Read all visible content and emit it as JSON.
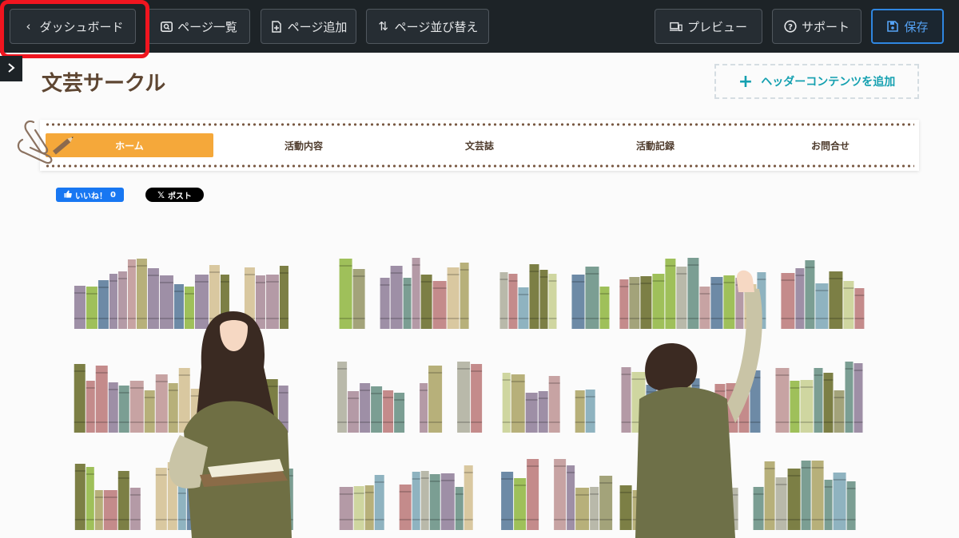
{
  "toolbar": {
    "dashboard_label": "ダッシュボード",
    "page_list_label": "ページ一覧",
    "add_page_label": "ページ追加",
    "reorder_label": "ページ並び替え",
    "preview_label": "プレビュー",
    "support_label": "サポート",
    "save_label": "保存"
  },
  "site": {
    "title": "文芸サークル",
    "add_header_label": "ヘッダーコンテンツを追加"
  },
  "nav": {
    "items": [
      {
        "label": "ホーム"
      },
      {
        "label": "活動内容"
      },
      {
        "label": "文芸誌"
      },
      {
        "label": "活動記録"
      },
      {
        "label": "お問合せ"
      }
    ]
  },
  "social": {
    "like_label": "いいね！",
    "like_count": "0",
    "post_label": "ポスト"
  },
  "colors": {
    "toolbar_bg": "#1d2327",
    "save_accent": "#2f86e0",
    "nav_active": "#f5a83a",
    "title_brown": "#5e4632",
    "header_add_teal": "#14a0b0",
    "highlight_red": "#f0151f"
  }
}
